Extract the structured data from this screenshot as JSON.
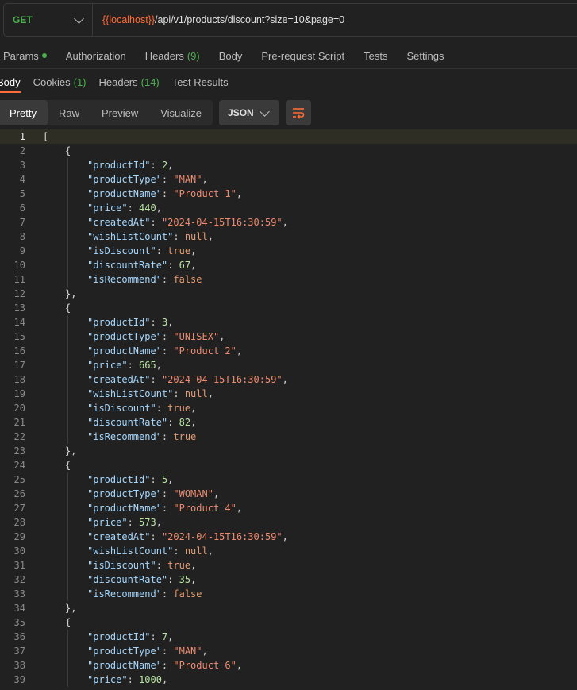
{
  "request": {
    "method": "GET",
    "url_var": "{{localhost}}",
    "url_path": "/api/v1/products/discount?size=10&page=0"
  },
  "request_tabs": {
    "params": "Params",
    "authorization": "Authorization",
    "headers": "Headers",
    "headers_count": "(9)",
    "body": "Body",
    "prerequest": "Pre-request Script",
    "tests": "Tests",
    "settings": "Settings"
  },
  "response_tabs": {
    "body": "Body",
    "cookies": "Cookies",
    "cookies_count": "(1)",
    "headers": "Headers",
    "headers_count": "(14)",
    "test_results": "Test Results"
  },
  "view_modes": {
    "pretty": "Pretty",
    "raw": "Raw",
    "preview": "Preview",
    "visualize": "Visualize",
    "format": "JSON"
  },
  "icons": {
    "method_dropdown": "chevron-down-icon",
    "format_dropdown": "chevron-down-icon",
    "wrap": "wrap-lines-icon"
  },
  "response_lines": [
    [
      [
        "b",
        "["
      ]
    ],
    [
      [
        "b",
        "{"
      ]
    ],
    [
      [
        "k",
        "\"productId\""
      ],
      [
        "p",
        ": "
      ],
      [
        "n",
        "2"
      ],
      [
        "p",
        ","
      ]
    ],
    [
      [
        "k",
        "\"productType\""
      ],
      [
        "p",
        ": "
      ],
      [
        "s",
        "\"MAN\""
      ],
      [
        "p",
        ","
      ]
    ],
    [
      [
        "k",
        "\"productName\""
      ],
      [
        "p",
        ": "
      ],
      [
        "s",
        "\"Product 1\""
      ],
      [
        "p",
        ","
      ]
    ],
    [
      [
        "k",
        "\"price\""
      ],
      [
        "p",
        ": "
      ],
      [
        "n",
        "440"
      ],
      [
        "p",
        ","
      ]
    ],
    [
      [
        "k",
        "\"createdAt\""
      ],
      [
        "p",
        ": "
      ],
      [
        "s",
        "\"2024-04-15T16:30:59\""
      ],
      [
        "p",
        ","
      ]
    ],
    [
      [
        "k",
        "\"wishListCount\""
      ],
      [
        "p",
        ": "
      ],
      [
        "l",
        "null"
      ],
      [
        "p",
        ","
      ]
    ],
    [
      [
        "k",
        "\"isDiscount\""
      ],
      [
        "p",
        ": "
      ],
      [
        "l",
        "true"
      ],
      [
        "p",
        ","
      ]
    ],
    [
      [
        "k",
        "\"discountRate\""
      ],
      [
        "p",
        ": "
      ],
      [
        "n",
        "67"
      ],
      [
        "p",
        ","
      ]
    ],
    [
      [
        "k",
        "\"isRecommend\""
      ],
      [
        "p",
        ": "
      ],
      [
        "l",
        "false"
      ]
    ],
    [
      [
        "b",
        "},"
      ]
    ],
    [
      [
        "b",
        "{"
      ]
    ],
    [
      [
        "k",
        "\"productId\""
      ],
      [
        "p",
        ": "
      ],
      [
        "n",
        "3"
      ],
      [
        "p",
        ","
      ]
    ],
    [
      [
        "k",
        "\"productType\""
      ],
      [
        "p",
        ": "
      ],
      [
        "s",
        "\"UNISEX\""
      ],
      [
        "p",
        ","
      ]
    ],
    [
      [
        "k",
        "\"productName\""
      ],
      [
        "p",
        ": "
      ],
      [
        "s",
        "\"Product 2\""
      ],
      [
        "p",
        ","
      ]
    ],
    [
      [
        "k",
        "\"price\""
      ],
      [
        "p",
        ": "
      ],
      [
        "n",
        "665"
      ],
      [
        "p",
        ","
      ]
    ],
    [
      [
        "k",
        "\"createdAt\""
      ],
      [
        "p",
        ": "
      ],
      [
        "s",
        "\"2024-04-15T16:30:59\""
      ],
      [
        "p",
        ","
      ]
    ],
    [
      [
        "k",
        "\"wishListCount\""
      ],
      [
        "p",
        ": "
      ],
      [
        "l",
        "null"
      ],
      [
        "p",
        ","
      ]
    ],
    [
      [
        "k",
        "\"isDiscount\""
      ],
      [
        "p",
        ": "
      ],
      [
        "l",
        "true"
      ],
      [
        "p",
        ","
      ]
    ],
    [
      [
        "k",
        "\"discountRate\""
      ],
      [
        "p",
        ": "
      ],
      [
        "n",
        "82"
      ],
      [
        "p",
        ","
      ]
    ],
    [
      [
        "k",
        "\"isRecommend\""
      ],
      [
        "p",
        ": "
      ],
      [
        "l",
        "true"
      ]
    ],
    [
      [
        "b",
        "},"
      ]
    ],
    [
      [
        "b",
        "{"
      ]
    ],
    [
      [
        "k",
        "\"productId\""
      ],
      [
        "p",
        ": "
      ],
      [
        "n",
        "5"
      ],
      [
        "p",
        ","
      ]
    ],
    [
      [
        "k",
        "\"productType\""
      ],
      [
        "p",
        ": "
      ],
      [
        "s",
        "\"WOMAN\""
      ],
      [
        "p",
        ","
      ]
    ],
    [
      [
        "k",
        "\"productName\""
      ],
      [
        "p",
        ": "
      ],
      [
        "s",
        "\"Product 4\""
      ],
      [
        "p",
        ","
      ]
    ],
    [
      [
        "k",
        "\"price\""
      ],
      [
        "p",
        ": "
      ],
      [
        "n",
        "573"
      ],
      [
        "p",
        ","
      ]
    ],
    [
      [
        "k",
        "\"createdAt\""
      ],
      [
        "p",
        ": "
      ],
      [
        "s",
        "\"2024-04-15T16:30:59\""
      ],
      [
        "p",
        ","
      ]
    ],
    [
      [
        "k",
        "\"wishListCount\""
      ],
      [
        "p",
        ": "
      ],
      [
        "l",
        "null"
      ],
      [
        "p",
        ","
      ]
    ],
    [
      [
        "k",
        "\"isDiscount\""
      ],
      [
        "p",
        ": "
      ],
      [
        "l",
        "true"
      ],
      [
        "p",
        ","
      ]
    ],
    [
      [
        "k",
        "\"discountRate\""
      ],
      [
        "p",
        ": "
      ],
      [
        "n",
        "35"
      ],
      [
        "p",
        ","
      ]
    ],
    [
      [
        "k",
        "\"isRecommend\""
      ],
      [
        "p",
        ": "
      ],
      [
        "l",
        "false"
      ]
    ],
    [
      [
        "b",
        "},"
      ]
    ],
    [
      [
        "b",
        "{"
      ]
    ],
    [
      [
        "k",
        "\"productId\""
      ],
      [
        "p",
        ": "
      ],
      [
        "n",
        "7"
      ],
      [
        "p",
        ","
      ]
    ],
    [
      [
        "k",
        "\"productType\""
      ],
      [
        "p",
        ": "
      ],
      [
        "s",
        "\"MAN\""
      ],
      [
        "p",
        ","
      ]
    ],
    [
      [
        "k",
        "\"productName\""
      ],
      [
        "p",
        ": "
      ],
      [
        "s",
        "\"Product 6\""
      ],
      [
        "p",
        ","
      ]
    ],
    [
      [
        "k",
        "\"price\""
      ],
      [
        "p",
        ": "
      ],
      [
        "n",
        "1000"
      ],
      [
        "p",
        ","
      ]
    ]
  ]
}
